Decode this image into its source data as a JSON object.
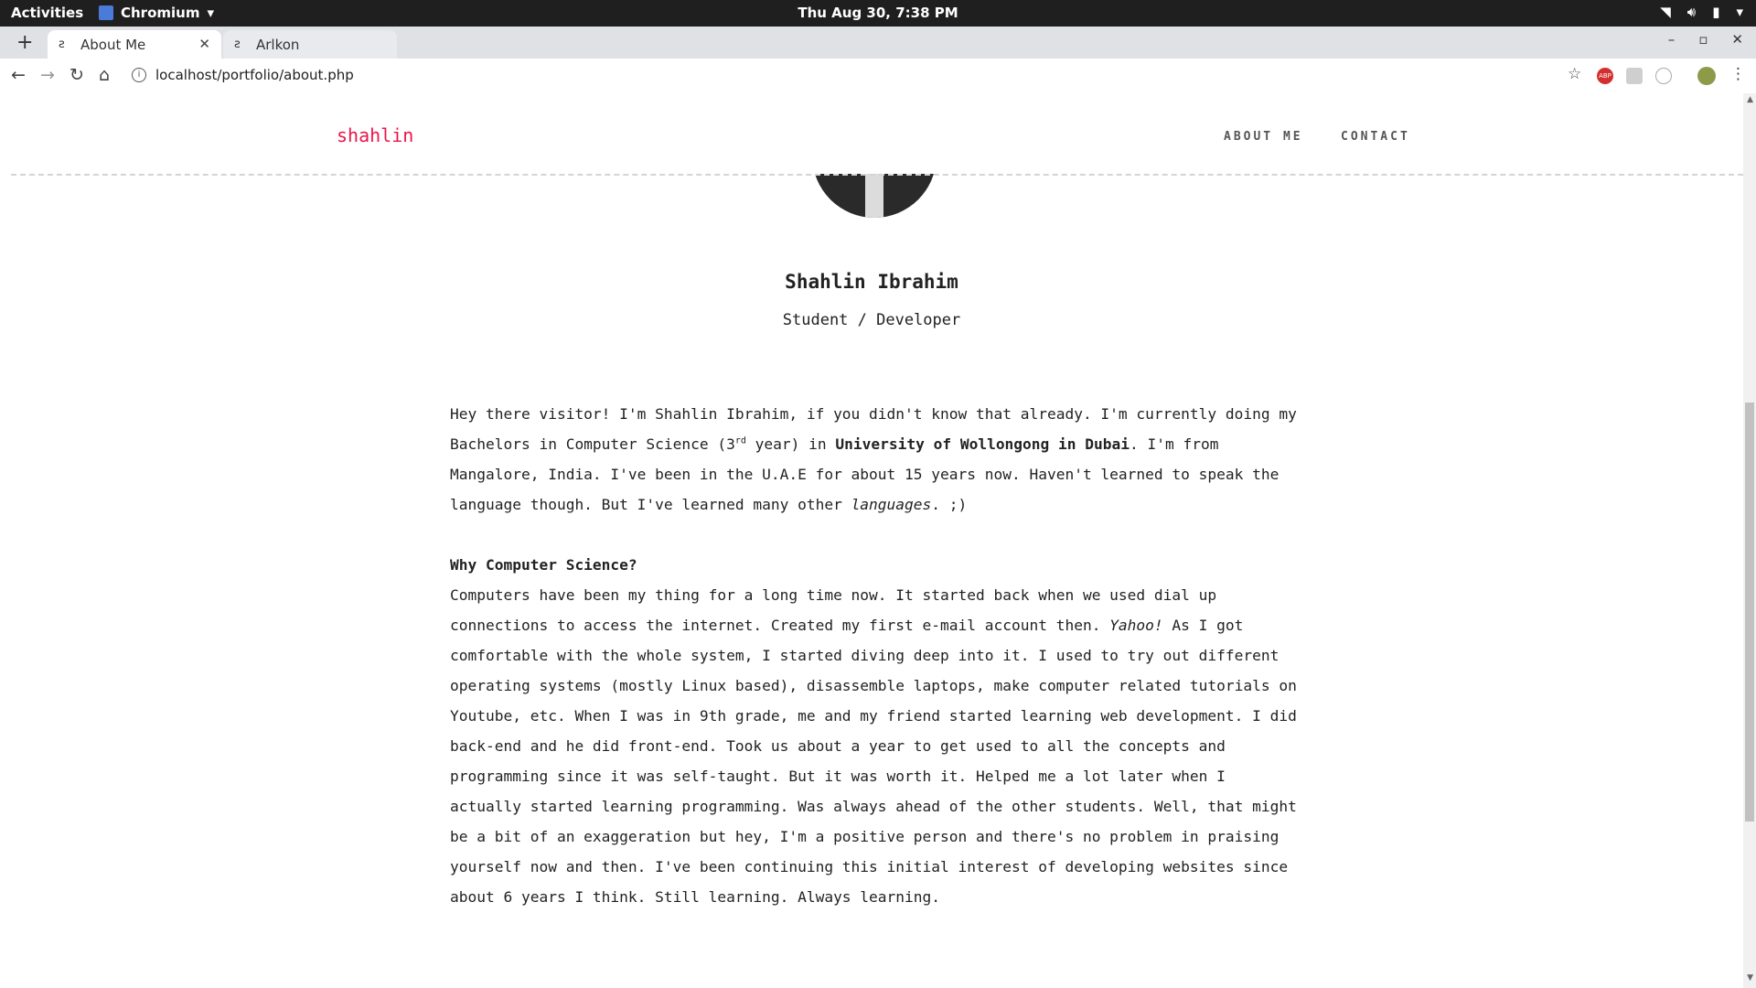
{
  "system_bar": {
    "activities": "Activities",
    "app_name": "Chromium",
    "clock": "Thu Aug 30,  7:38 PM"
  },
  "browser": {
    "tabs": [
      {
        "label": "About Me",
        "active": true
      },
      {
        "label": "Arlkon",
        "active": false
      }
    ],
    "url": "localhost/portfolio/about.php",
    "extensions": [
      "star-icon",
      "adblock-icon",
      "cast-icon",
      "ghost-icon",
      "profile-avatar"
    ]
  },
  "site": {
    "brand": "shahlin",
    "nav": [
      "ABOUT ME",
      "CONTACT"
    ],
    "brand_color": "#e8174b"
  },
  "profile": {
    "name": "Shahlin Ibrahim",
    "role": "Student / Developer"
  },
  "intro": {
    "p1_a": "Hey there visitor! I'm Shahlin Ibrahim, if you didn't know that already. I'm currently doing my Bachelors in Computer Science (3",
    "p1_sup": "rd",
    "p1_b": " year) in ",
    "p1_strong": "University of Wollongong in Dubai",
    "p1_c": ". I'm from Mangalore, India. I've been in the U.A.E for about 15 years now. Haven't learned to speak the language though. But I've learned many other ",
    "p1_em": "languages",
    "p1_d": ". ;)"
  },
  "why": {
    "heading": "Why Computer Science?",
    "p_a": "Computers have been my thing for a long time now. It started back when we used dial up connections to access the internet. Created my first e-mail account then. ",
    "p_em": "Yahoo!",
    "p_b": " As I got comfortable with the whole system, I started diving deep into it. I used to try out different operating systems (mostly Linux based), disassemble laptops, make computer related tutorials on Youtube, etc. When I was in 9th grade, me and my friend started learning web development. I did back-end and he did front-end. Took us about a year to get used to all the concepts and programming since it was self-taught. But it was worth it. Helped me a lot later when I actually started learning programming. Was always ahead of the other students. Well, that might be a bit of an exaggeration but hey, I'm a positive person and there's no problem in praising yourself now and then. I've been continuing this initial interest of developing websites since about 6 years I think. Still learning. Always learning."
  }
}
